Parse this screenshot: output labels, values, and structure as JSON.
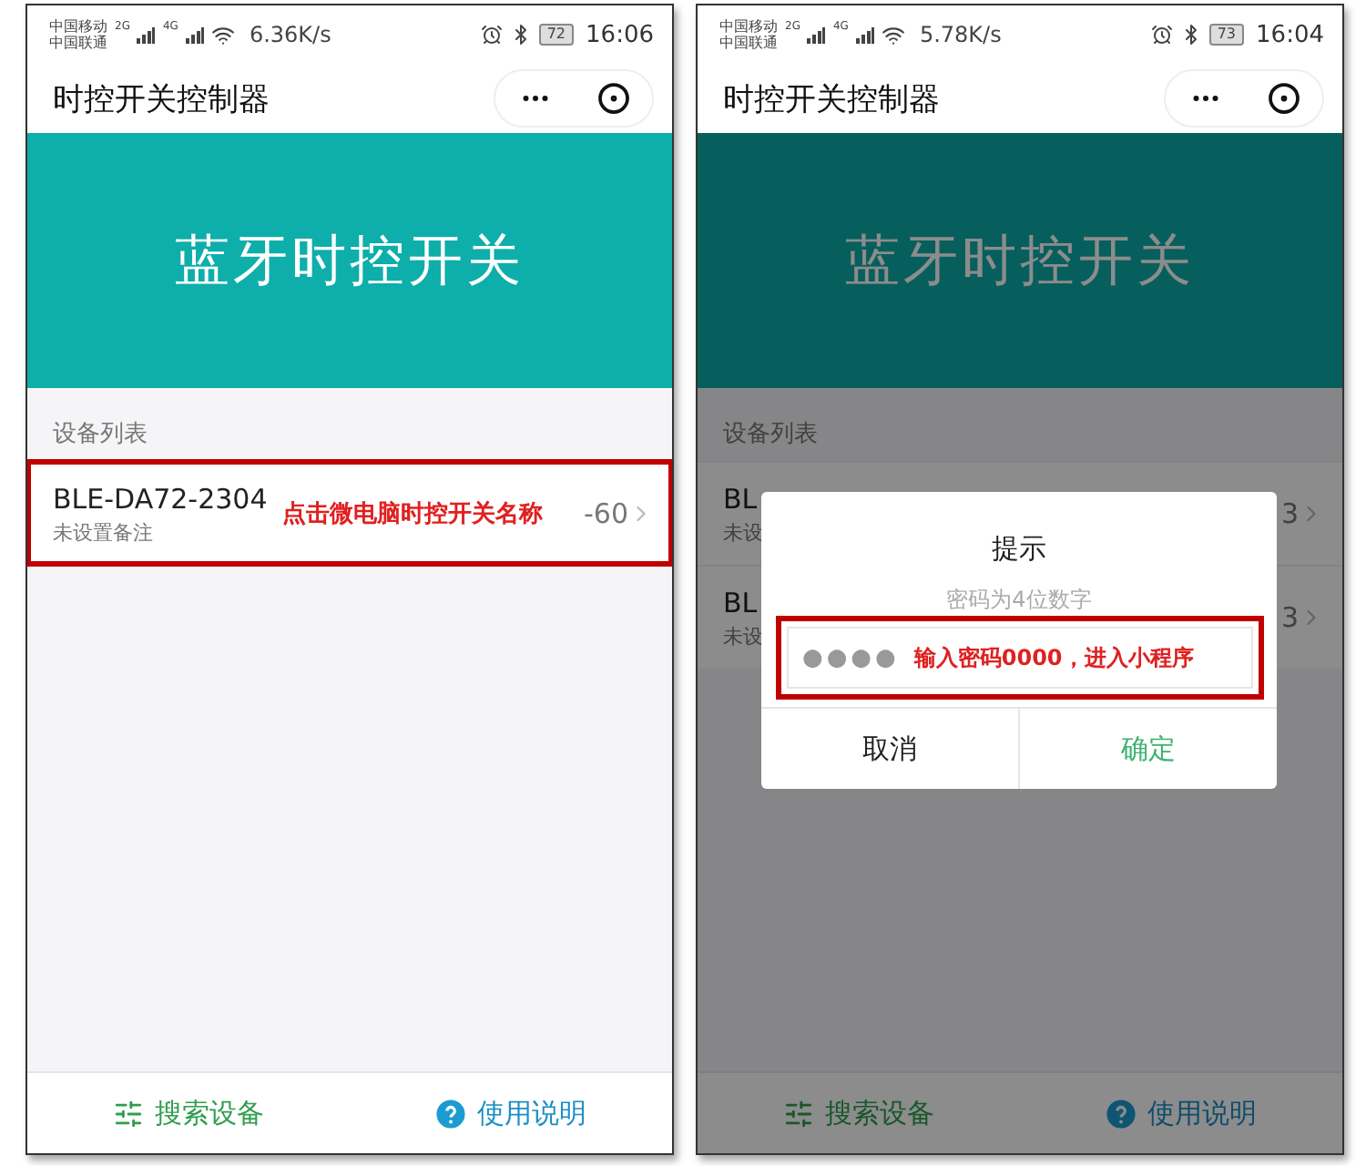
{
  "screens": [
    {
      "status_bar": {
        "carriers": [
          "中国移动",
          "中国联通"
        ],
        "networks": [
          "2G",
          "4G"
        ],
        "speed": "6.36K/s",
        "battery": "72",
        "time": "16:06"
      },
      "nav_title": "时控开关控制器",
      "banner_title": "蓝牙时控开关",
      "section_label": "设备列表",
      "dimmed": false,
      "devices": [
        {
          "name": "BLE-DA72-2304",
          "remark": "未设置备注",
          "rssi": "-60",
          "highlighted": true,
          "annotation": "点击微电脑时控开关名称"
        }
      ],
      "bottom_bar": [
        {
          "kind": "search",
          "label": "搜索设备"
        },
        {
          "kind": "help",
          "label": "使用说明"
        }
      ]
    },
    {
      "status_bar": {
        "carriers": [
          "中国移动",
          "中国联通"
        ],
        "networks": [
          "2G",
          "4G"
        ],
        "speed": "5.78K/s",
        "battery": "73",
        "time": "16:04"
      },
      "nav_title": "时控开关控制器",
      "banner_title": "蓝牙时控开关",
      "section_label": "设备列表",
      "dimmed": true,
      "devices": [
        {
          "name": "BL",
          "remark": "未设",
          "rssi": "3",
          "highlighted": false
        },
        {
          "name": "BL",
          "remark": "未设",
          "rssi": "3",
          "highlighted": false
        }
      ],
      "dialog": {
        "title": "提示",
        "message": "密码为4位数字",
        "masked_value": "●●●●",
        "annotation": "输入密码0000，进入小程序",
        "cancel": "取消",
        "confirm": "确定"
      },
      "bottom_bar": [
        {
          "kind": "search",
          "label": "搜索设备"
        },
        {
          "kind": "help",
          "label": "使用说明"
        }
      ]
    }
  ]
}
